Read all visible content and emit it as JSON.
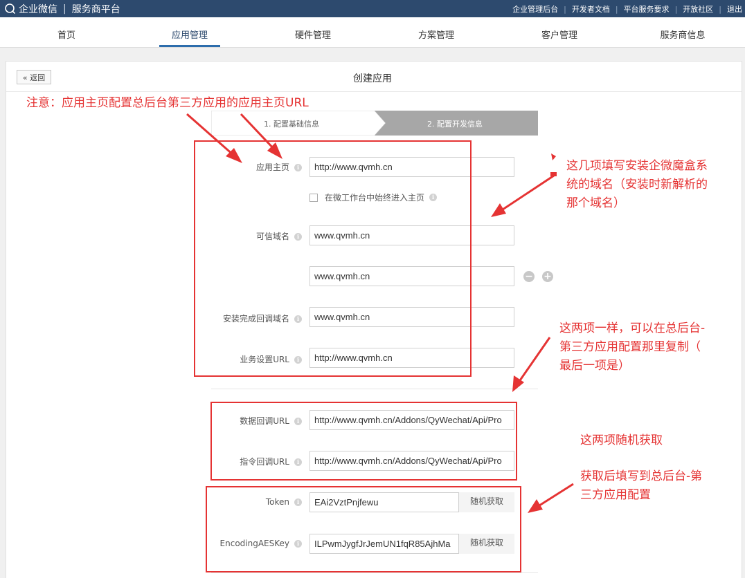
{
  "topbar": {
    "brand": "企业微信",
    "separator": "|",
    "subtitle": "服务商平台",
    "links": [
      "企业管理后台",
      "开发者文档",
      "平台服务要求",
      "开放社区",
      "退出"
    ]
  },
  "nav": {
    "items": [
      "首页",
      "应用管理",
      "硬件管理",
      "方案管理",
      "客户管理",
      "服务商信息"
    ],
    "active": "应用管理"
  },
  "page": {
    "back_label": "« 返回",
    "title": "创建应用"
  },
  "steps": {
    "step1": "1. 配置基础信息",
    "step2": "2. 配置开发信息"
  },
  "form": {
    "homepage": {
      "label": "应用主页",
      "value": "http://www.qvmh.cn"
    },
    "always_enter": {
      "label": "在微工作台中始终进入主页",
      "checked": false
    },
    "trusted_domain": {
      "label": "可信域名",
      "values": [
        "www.qvmh.cn",
        "www.qvmh.cn"
      ]
    },
    "callback_domain": {
      "label": "安装完成回调域名",
      "value": "www.qvmh.cn"
    },
    "business_url": {
      "label": "业务设置URL",
      "value": "http://www.qvmh.cn"
    },
    "data_callback": {
      "label": "数据回调URL",
      "value": "http://www.qvmh.cn/Addons/QyWechat/Api/Pro"
    },
    "command_callback": {
      "label": "指令回调URL",
      "value": "http://www.qvmh.cn/Addons/QyWechat/Api/Pro"
    },
    "token": {
      "label": "Token",
      "value": "EAi2VztPnjfewu"
    },
    "aes_key": {
      "label": "EncodingAESKey",
      "value": "ILPwmJygfJrJemUN1fqR85AjhMa"
    },
    "random_button": "随机获取",
    "minus_icon": "−",
    "plus_icon": "+",
    "info_glyph": "i"
  },
  "annotations": {
    "top": "注意：应用主页配置总后台第三方应用的应用主页URL",
    "right1": [
      "这几项填写安装企微魔盒系",
      "统的域名（安装时新解析的",
      "那个域名）"
    ],
    "right2": [
      "这两项一样，可以在总后台-",
      "第三方应用配置那里复制（",
      "最后一项是）"
    ],
    "right3": "这两项随机获取",
    "right4": [
      "获取后填写到总后台-第",
      "三方应用配置"
    ],
    "color": "#e53333"
  },
  "colors": {
    "topbar": "#2d4a6e",
    "accent": "#2d6dac",
    "annotation_red": "#e53333"
  }
}
